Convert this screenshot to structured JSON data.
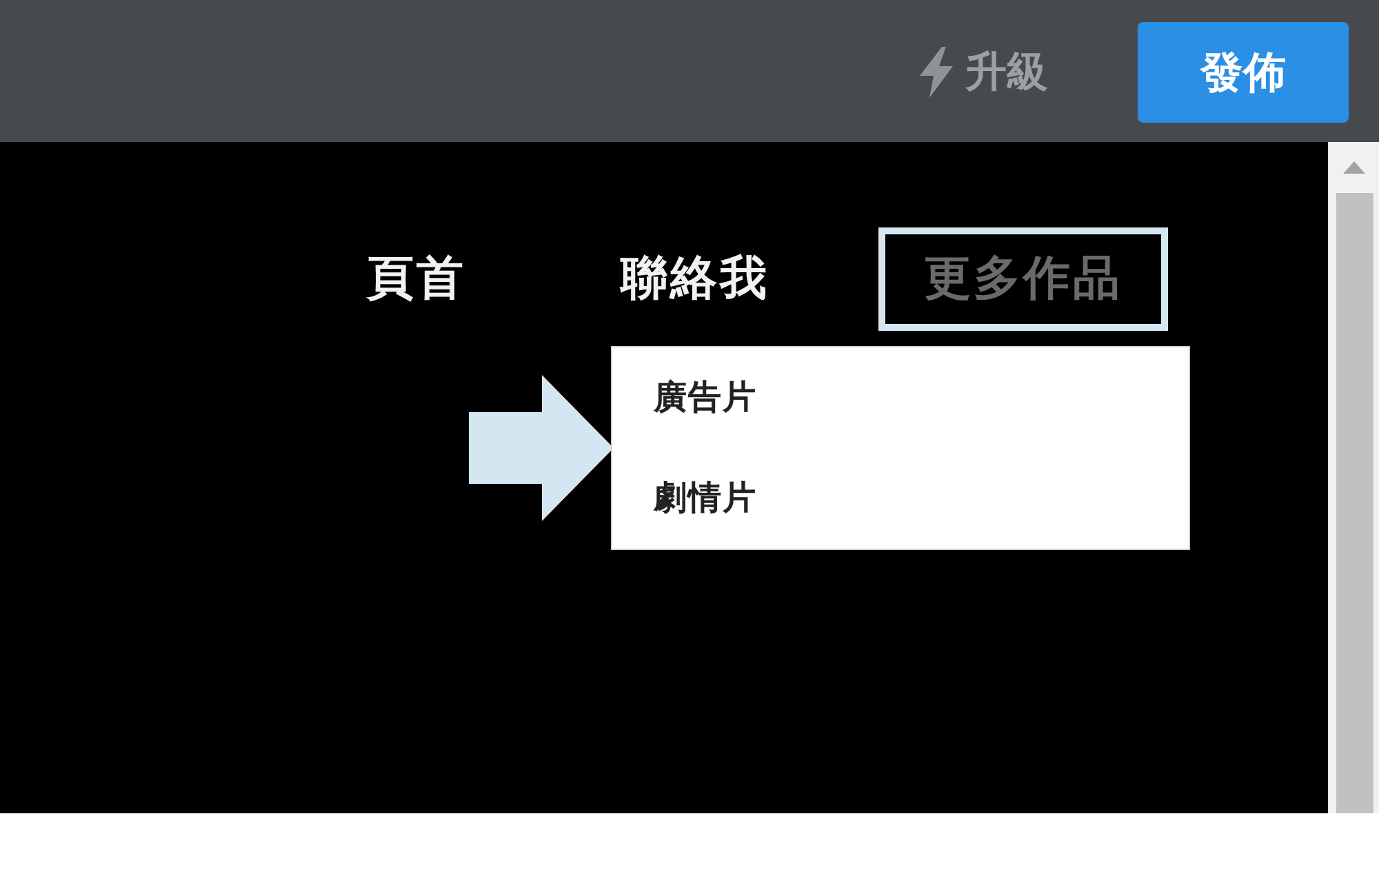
{
  "toolbar": {
    "upgrade_button": {
      "label": "升級"
    },
    "publish_button": {
      "label": "發佈"
    }
  },
  "nav": {
    "items": [
      {
        "label": "頁首",
        "highlighted": false,
        "expanded": false
      },
      {
        "label": "聯絡我",
        "highlighted": false,
        "expanded": false
      },
      {
        "label": "更多作品",
        "highlighted": true,
        "expanded": true,
        "children": [
          {
            "label": "廣告片"
          },
          {
            "label": "劇情片"
          }
        ]
      }
    ]
  }
}
